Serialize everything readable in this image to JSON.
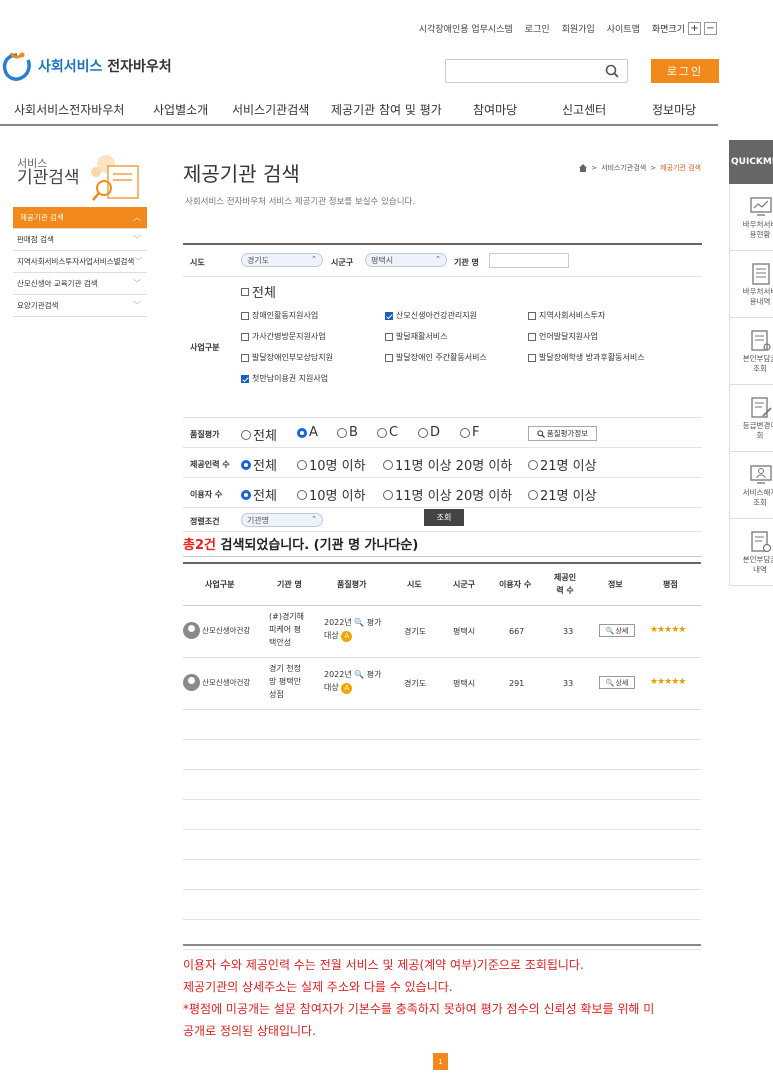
{
  "util": {
    "links": [
      "시각장애인용 업무시스템",
      "로그인",
      "회원가입",
      "사이트맵"
    ],
    "zoom_label": "화면크기",
    "zoom_in": "+",
    "zoom_out": "−"
  },
  "logo": {
    "part1": "사회서비스",
    "part2": "전자바우처"
  },
  "header": {
    "login_button": "로그인"
  },
  "gnb": [
    "사회서비스전자바우처",
    "사업별소개",
    "서비스기관검색",
    "제공기관 참여 및 평가",
    "참여마당",
    "신고센터",
    "정보마당"
  ],
  "lnb": {
    "title_small": "서비스",
    "title_big": "기관검색",
    "items": [
      "제공기관 검색",
      "판매점 검색",
      "지역사회서비스투자사업서비스별검색",
      "산모신생아 교육기관 검색",
      "요양기관검색"
    ]
  },
  "page": {
    "title": "제공기관 검색",
    "desc": "사회서비스 전자바우처 서비스 제공기관 정보를 보실수 있습니다.",
    "crumb": [
      "서비스기관검색",
      "제공기관 검색"
    ]
  },
  "form": {
    "sido_label": "시도",
    "sido_value": "경기도",
    "sigungu_label": "시군구",
    "sigungu_value": "평택시",
    "org_label": "기관 명",
    "org_value": "",
    "biz_label": "사업구분",
    "biz_all": "전체",
    "biz_options": [
      {
        "label": "장애인활동지원사업",
        "checked": false
      },
      {
        "label": "산모신생아건강관리지원",
        "checked": true
      },
      {
        "label": "지역사회서비스투자",
        "checked": false
      },
      {
        "label": "가사간병방문지원사업",
        "checked": false
      },
      {
        "label": "발달재활서비스",
        "checked": false
      },
      {
        "label": "언어발달지원사업",
        "checked": false
      },
      {
        "label": "발달장애인부모상담지원",
        "checked": false
      },
      {
        "label": "발달장애인 주간활동서비스",
        "checked": false
      },
      {
        "label": "발달장애학생 방과후활동서비스",
        "checked": false
      },
      {
        "label": "첫만남이용권 지원사업",
        "checked": true
      }
    ],
    "quality_label": "품질평가",
    "quality_options": [
      "전체",
      "A",
      "B",
      "C",
      "D",
      "F"
    ],
    "quality_selected": "A",
    "quality_info_btn": "품질평가정보",
    "staff_label": "제공인력 수",
    "count_options": [
      "전체",
      "10명 이하",
      "11명 이상 20명 이하",
      "21명 이상"
    ],
    "users_label": "이용자 수",
    "sort_label": "정렬조건",
    "sort_value": "기관명",
    "search_btn": "조회"
  },
  "result": {
    "count": "총2건",
    "suffix": " 검색되었습니다. (기관 명 가나다순)"
  },
  "table": {
    "headers": [
      "사업구분",
      "기관 명",
      "품질평가",
      "시도",
      "시군구",
      "이용자 수",
      "제공인력 수",
      "정보",
      "평점"
    ],
    "header_staff_l1": "제공인",
    "header_staff_l2": "력 수",
    "rows": [
      {
        "category": "산모신생아건강",
        "name_l1": "(#)경기해",
        "name_l2": "피케어 평",
        "name_l3": "택안성",
        "quality_l1": "2022년 🔍 평가",
        "quality_l2": "대상",
        "grade": "A",
        "sido": "경기도",
        "sigungu": "평택시",
        "users": "667",
        "staff": "33",
        "detail": "상세",
        "rating": "★★★★★"
      },
      {
        "category": "산모신생아건강",
        "name_l1": "경기 천정",
        "name_l2": "망 평택안",
        "name_l3": "성점",
        "quality_l1": "2022년 🔍 평가",
        "quality_l2": "대상",
        "grade": "A",
        "sido": "경기도",
        "sigungu": "평택시",
        "users": "291",
        "staff": "33",
        "detail": "상세",
        "rating": "★★★★★"
      }
    ]
  },
  "notes": [
    "이용자 수와 제공인력 수는 전월 서비스 및 제공(계약 여부)기준으로 조회됩니다.",
    "제공기관의 상세주소는 실제 주소와 다를 수 있습니다.",
    "*평점에 미공개는 설문 참여자가 기본수를 충족하지 못하여 평가 점수의 신뢰성 확보를 위해 미",
    "공개로 정의된 상태입니다."
  ],
  "pager": {
    "current": "1"
  },
  "quick": {
    "title": "QUICKMENU",
    "items": [
      {
        "l1": "바우처서비",
        "l2": "용현황"
      },
      {
        "l1": "바우처서비",
        "l2": "용내역"
      },
      {
        "l1": "본인부담금",
        "l2": "조회"
      },
      {
        "l1": "등급변경이",
        "l2": "회"
      },
      {
        "l1": "서비스해지",
        "l2": "조회"
      },
      {
        "l1": "본인부담금",
        "l2": "내역"
      }
    ]
  },
  "colors": {
    "accent": "#f28a1b",
    "red": "#e02020",
    "blue": "#1a64d8"
  }
}
